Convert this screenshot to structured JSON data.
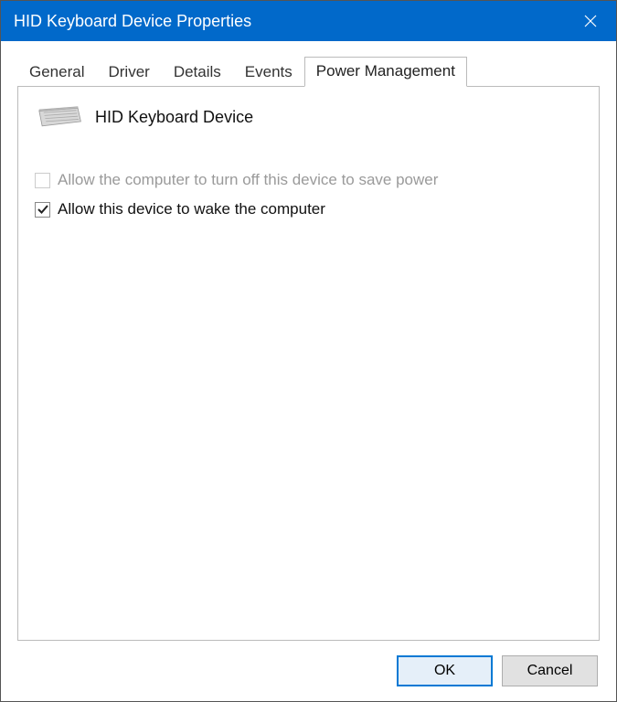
{
  "titlebar": {
    "title": "HID Keyboard Device Properties"
  },
  "tabs": {
    "t0": "General",
    "t1": "Driver",
    "t2": "Details",
    "t3": "Events",
    "t4": "Power Management"
  },
  "panel": {
    "device_name": "HID Keyboard Device",
    "opt_turnoff": "Allow the computer to turn off this device to save power",
    "opt_wake": "Allow this device to wake the computer"
  },
  "buttons": {
    "ok": "OK",
    "cancel": "Cancel"
  }
}
